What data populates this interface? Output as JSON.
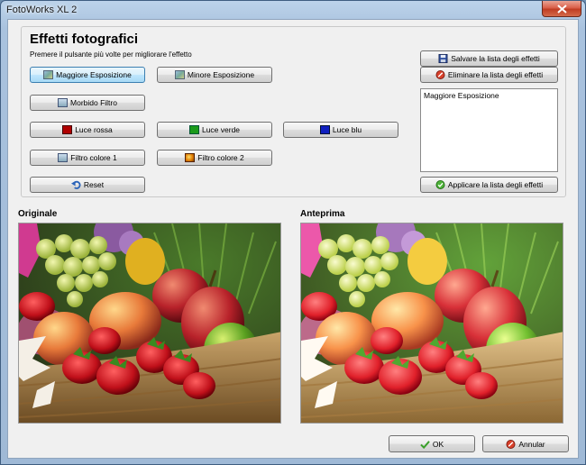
{
  "window": {
    "title": "FotoWorks XL 2"
  },
  "header": {
    "title": "Effetti fotografici",
    "subtitle": "Premere il pulsante più volte per migliorare l'effetto"
  },
  "effects": {
    "maggiore_esposizione": "Maggiore Esposizione",
    "minore_esposizione": "Minore Esposizione",
    "morbido_filtro": "Morbido Filtro",
    "luce_rossa": "Luce rossa",
    "luce_verde": "Luce verde",
    "luce_blu": "Luce blu",
    "filtro_colore_1": "Filtro colore 1",
    "filtro_colore_2": "Filtro colore 2",
    "reset": "Reset"
  },
  "effects_list": {
    "save_label": "Salvare la lista degli effetti",
    "delete_label": "Eliminare la lista degli effetti",
    "apply_label": "Applicare la lista degli effetti",
    "items": [
      "Maggiore Esposizione"
    ]
  },
  "preview": {
    "original_label": "Originale",
    "preview_label": "Anteprima"
  },
  "footer": {
    "ok_label": "OK",
    "cancel_label": "Annular"
  },
  "colors": {
    "luce_rossa": "#b00000",
    "luce_verde": "#1a9a1a",
    "luce_blu": "#1020c0",
    "active_button": "#bee6fd"
  }
}
